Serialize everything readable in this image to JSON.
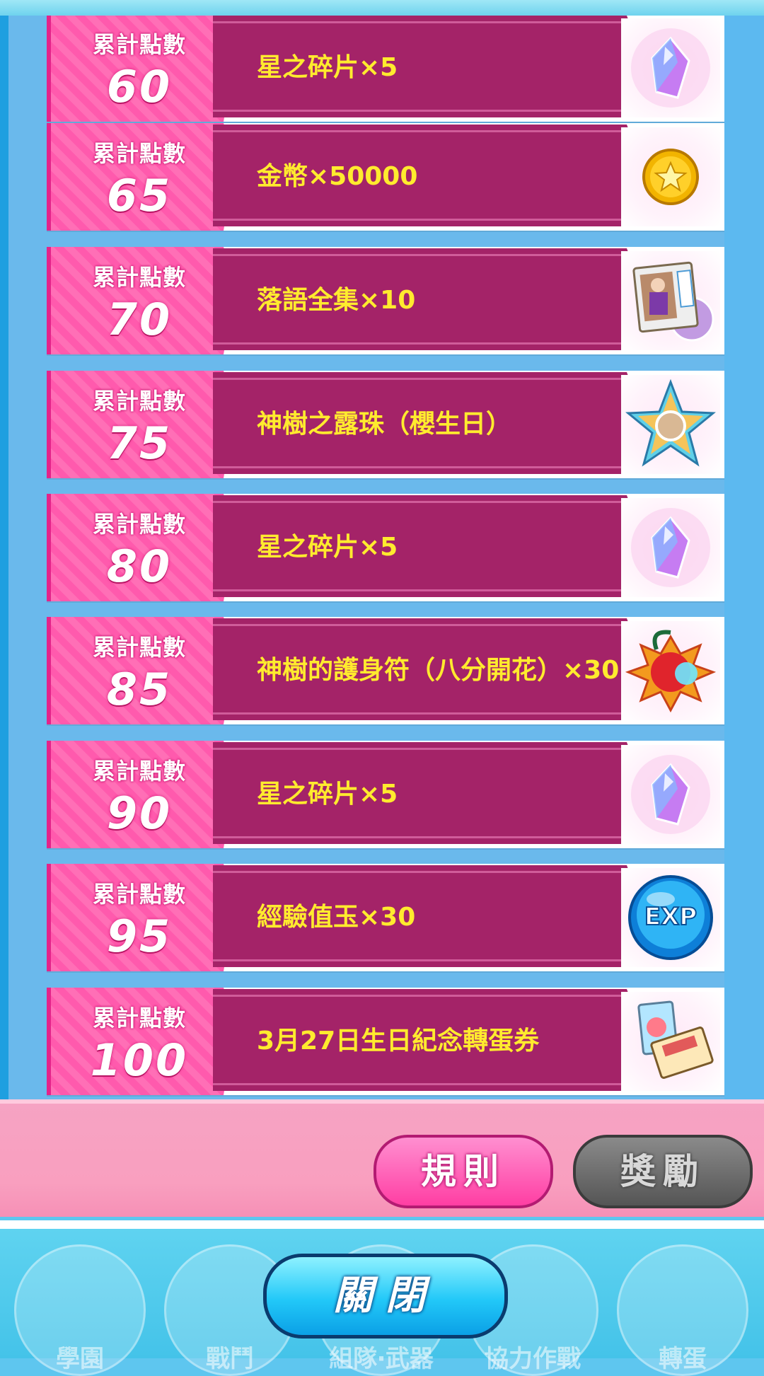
{
  "rank_label": "累計點數",
  "rows": [
    {
      "points": "60",
      "reward": "星之碎片×5",
      "icon": "star-fragment-icon"
    },
    {
      "points": "65",
      "reward": "金幣×50000",
      "icon": "gold-coin-icon"
    },
    {
      "points": "70",
      "reward": "落語全集×10",
      "icon": "rakugo-collection-icon"
    },
    {
      "points": "75",
      "reward": "神樹之露珠（櫻生日）",
      "icon": "dew-star-badge-icon"
    },
    {
      "points": "80",
      "reward": "星之碎片×5",
      "icon": "star-fragment-icon"
    },
    {
      "points": "85",
      "reward": "神樹的護身符（八分開花）×30",
      "icon": "amulet-icon"
    },
    {
      "points": "90",
      "reward": "星之碎片×5",
      "icon": "star-fragment-icon"
    },
    {
      "points": "95",
      "reward": "經驗值玉×30",
      "icon": "exp-orb-icon"
    },
    {
      "points": "100",
      "reward": "3月27日生日紀念轉蛋券",
      "icon": "birthday-gacha-ticket-icon"
    }
  ],
  "buttons": {
    "rules": "規則",
    "rewards": "獎勵",
    "close": "關閉"
  },
  "nav": [
    "學園",
    "戰鬥",
    "組隊‧武器",
    "協力作戰",
    "轉蛋"
  ],
  "exp_text": "EXP",
  "colors": {
    "accent_pink": "#ff5aad",
    "band": "#a42368",
    "reward_text": "#ffeb2e",
    "close_button": "#22c8f8"
  }
}
